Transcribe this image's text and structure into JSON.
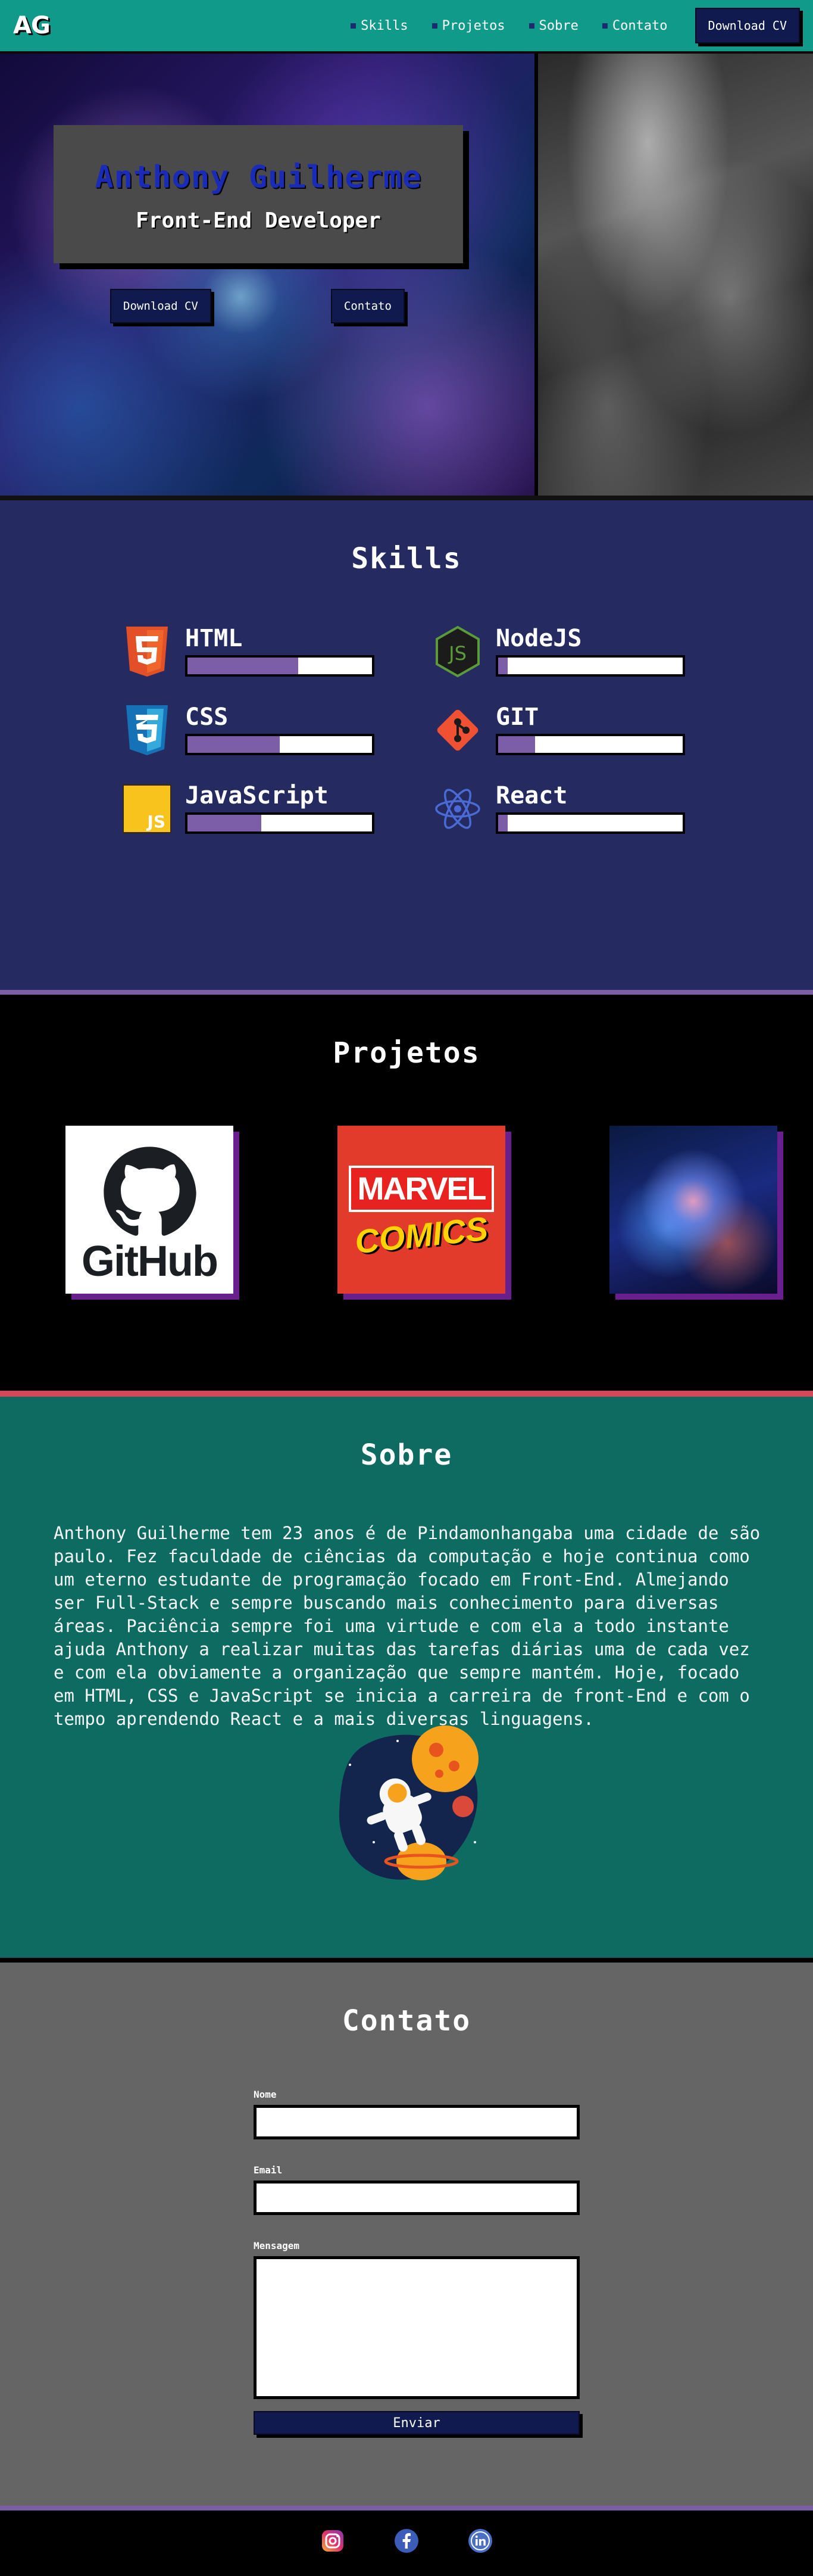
{
  "header": {
    "logo": "AG",
    "nav": [
      "Skills",
      "Projetos",
      "Sobre",
      "Contato"
    ],
    "download_label": "Download CV"
  },
  "hero": {
    "name": "Anthony Guilherme",
    "role": "Front-End Developer",
    "download_label": "Download CV",
    "contact_label": "Contato"
  },
  "skills": {
    "title": "Skills",
    "items": [
      {
        "name": "HTML",
        "level": 0.6,
        "icon": "html5-icon"
      },
      {
        "name": "NodeJS",
        "level": 0.05,
        "icon": "nodejs-icon"
      },
      {
        "name": "CSS",
        "level": 0.5,
        "icon": "css3-icon"
      },
      {
        "name": "GIT",
        "level": 0.2,
        "icon": "git-icon"
      },
      {
        "name": "JavaScript",
        "level": 0.4,
        "icon": "javascript-icon"
      },
      {
        "name": "React",
        "level": 0.05,
        "icon": "react-icon"
      }
    ]
  },
  "projetos": {
    "title": "Projetos",
    "items": [
      {
        "name": "github",
        "label": "GitHub"
      },
      {
        "name": "marvel",
        "label_top": "MARVEL",
        "label_bottom": "COMICS"
      },
      {
        "name": "cosmic"
      }
    ]
  },
  "sobre": {
    "title": "Sobre",
    "text": "Anthony Guilherme tem 23 anos é de Pindamonhangaba uma cidade de são paulo. Fez faculdade de ciências da computação e hoje continua como um eterno estudante de programação focado em Front-End. Almejando ser Full-Stack e sempre buscando mais conhecimento para diversas áreas. Paciência sempre foi uma virtude e com ela a todo instante ajuda Anthony a realizar muitas das tarefas diárias uma de cada vez e com ela obviamente a organização que sempre mantém. Hoje, focado em HTML, CSS e JavaScript se inicia a carreira de front-End e com o tempo aprendendo React e a mais diversas linguagens."
  },
  "contato": {
    "title": "Contato",
    "name_label": "Nome",
    "email_label": "Email",
    "message_label": "Mensagem",
    "submit_label": "Enviar"
  },
  "footer": {
    "icons": [
      "instagram-icon",
      "facebook-icon",
      "linkedin-icon"
    ]
  },
  "colors": {
    "header": "#109a8a",
    "skills_bg": "#252b60",
    "skill_fill": "#7b5ea7",
    "sobre_bg": "#0d6b62",
    "contato_bg": "#656565",
    "button": "#111a4e"
  }
}
